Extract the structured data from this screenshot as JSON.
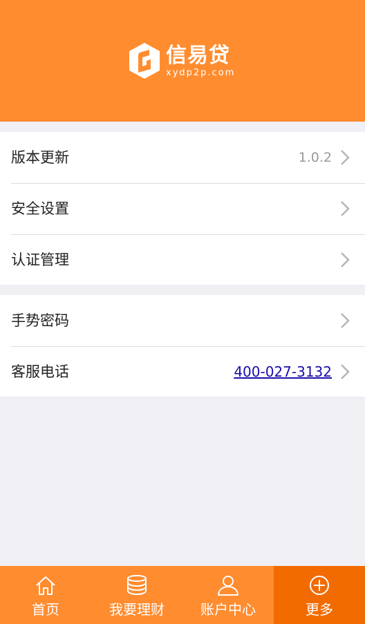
{
  "app": {
    "name": "信易贷",
    "domain": "xydp2p.com"
  },
  "settings": {
    "group1": [
      {
        "label": "版本更新",
        "value": "1.0.2"
      },
      {
        "label": "安全设置"
      },
      {
        "label": "认证管理"
      }
    ],
    "group2": [
      {
        "label": "手势密码"
      },
      {
        "label": "客服电话",
        "link": "400-027-3132"
      }
    ]
  },
  "tabs": [
    {
      "label": "首页",
      "icon": "home-icon"
    },
    {
      "label": "我要理财",
      "icon": "coins-stack-icon"
    },
    {
      "label": "账户中心",
      "icon": "user-icon"
    },
    {
      "label": "更多",
      "icon": "plus-circle-icon",
      "active": true
    }
  ],
  "colors": {
    "brand": "#ff8c2f",
    "brand_active": "#f26b00",
    "background": "#efeff4",
    "link": "#1a0dab"
  }
}
